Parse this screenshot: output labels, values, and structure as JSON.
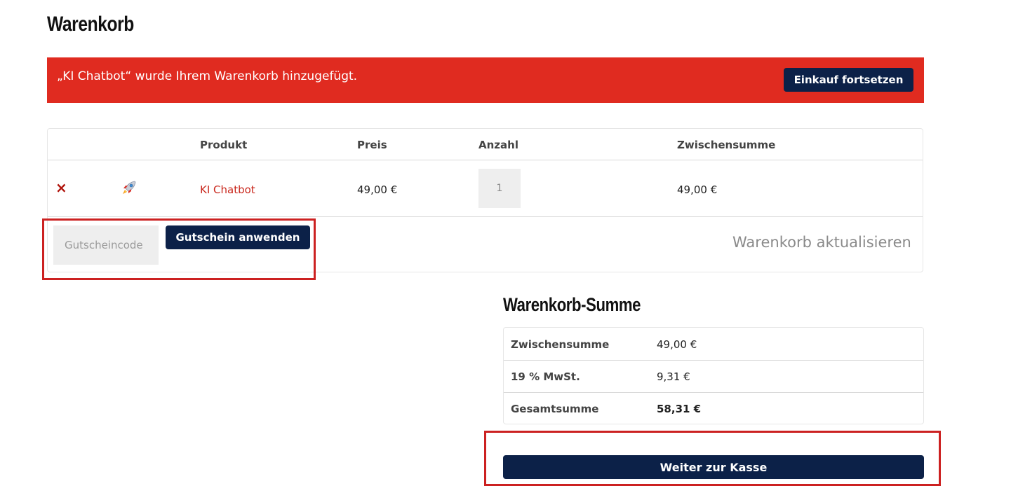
{
  "page": {
    "title": "Warenkorb"
  },
  "notice": {
    "message": "„KI Chatbot“ wurde Ihrem Warenkorb hinzugefügt.",
    "continue_label": "Einkauf fortsetzen"
  },
  "cart": {
    "headers": {
      "product": "Produkt",
      "price": "Preis",
      "quantity": "Anzahl",
      "subtotal": "Zwischensumme"
    },
    "items": [
      {
        "remove_label": "×",
        "thumbnail_icon": "rocket-icon",
        "name": "KI Chatbot",
        "price": "49,00 €",
        "quantity": "1",
        "subtotal": "49,00 €"
      }
    ],
    "coupon_placeholder": "Gutscheincode",
    "apply_coupon_label": "Gutschein anwenden",
    "update_cart_label": "Warenkorb aktualisieren"
  },
  "totals": {
    "title": "Warenkorb-Summe",
    "rows": [
      {
        "label": "Zwischensumme",
        "value": "49,00 €"
      },
      {
        "label": "19 % MwSt.",
        "value": "9,31 €"
      },
      {
        "label": "Gesamtsumme",
        "value": "58,31 €"
      }
    ],
    "checkout_label": "Weiter zur Kasse"
  },
  "colors": {
    "notice_bg": "#e02b20",
    "button_bg": "#0c2148",
    "link": "#c9271c",
    "highlight": "#cc2121"
  }
}
